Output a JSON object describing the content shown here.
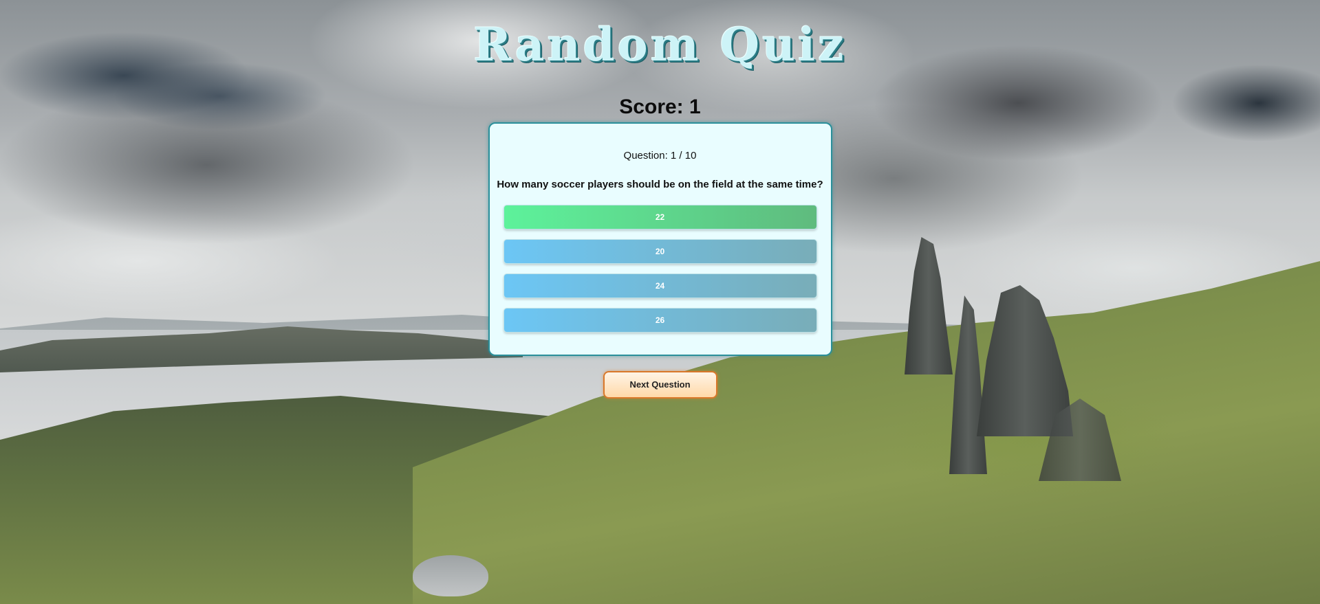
{
  "app": {
    "title": "Random Quiz",
    "score_label": "Score: 1"
  },
  "quiz": {
    "question_number": "Question: 1 / 10",
    "question_text": "How many soccer players should be on the field at the same time?",
    "answers": [
      {
        "label": "22",
        "state": "correct"
      },
      {
        "label": "20",
        "state": "default"
      },
      {
        "label": "24",
        "state": "default"
      },
      {
        "label": "26",
        "state": "default"
      }
    ],
    "next_label": "Next Question"
  },
  "colors": {
    "title_fill": "#cdf3f7",
    "title_shadow": "#2b7d86",
    "card_bg": "#e9fdff",
    "card_border": "#2a8f9a",
    "correct_answer": "#5df29b",
    "answer_default": "#6cc6f5",
    "next_button_border": "#d9782a"
  },
  "background": {
    "description_icon": "landscape-background"
  }
}
